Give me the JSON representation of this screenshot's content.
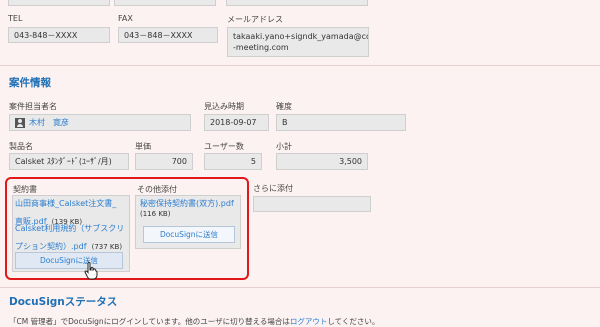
{
  "contact": {
    "tel_label": "TEL",
    "tel_value": "043-848－XXXX",
    "fax_label": "FAX",
    "fax_value": "043－848－XXXX",
    "email_label": "メールアドレス",
    "email_value_line1": "takaaki.yano+signdk_yamada@co",
    "email_value_line2": "-meeting.com"
  },
  "case": {
    "section_title": "案件情報",
    "owner_label": "案件担当者名",
    "owner_value": "木村　寛彦",
    "forecast_label": "見込み時期",
    "forecast_value": "2018-09-07",
    "certainty_label": "確度",
    "certainty_value": "B",
    "product_label": "製品名",
    "product_value": "Calsket ｽﾀﾝﾀﾞｰﾄﾞ(ﾕｰｻﾞ/月)",
    "unit_price_label": "単価",
    "unit_price_value": "700",
    "users_label": "ユーザー数",
    "users_value": "5",
    "subtotal_label": "小計",
    "subtotal_value": "3,500"
  },
  "attachments": {
    "contract_label": "契約書",
    "contract_files": [
      {
        "name_line1": "山田商事様_Calsket注文書_",
        "name_line2": "直販.pdf",
        "size": "(139 KB)"
      },
      {
        "name_line1": "Calsket利用規約（サブスクリ",
        "name_line2": "プション契約）.pdf",
        "size": "(737 KB)"
      }
    ],
    "contract_button": "DocuSignに送信",
    "other_label": "その他添付",
    "other_files": [
      {
        "name_line1": "秘密保持契約書(双方).pdf",
        "size": "(116 KB)"
      }
    ],
    "other_button": "DocuSignに送信",
    "more_label": "さらに添付"
  },
  "docusign": {
    "section_title": "DocuSignステータス",
    "note": "「CM 管理者」でDocuSignにログインしています。他のユーザに切り替える場合は",
    "note_link": "ログアウト",
    "note_tail": "してください。"
  }
}
